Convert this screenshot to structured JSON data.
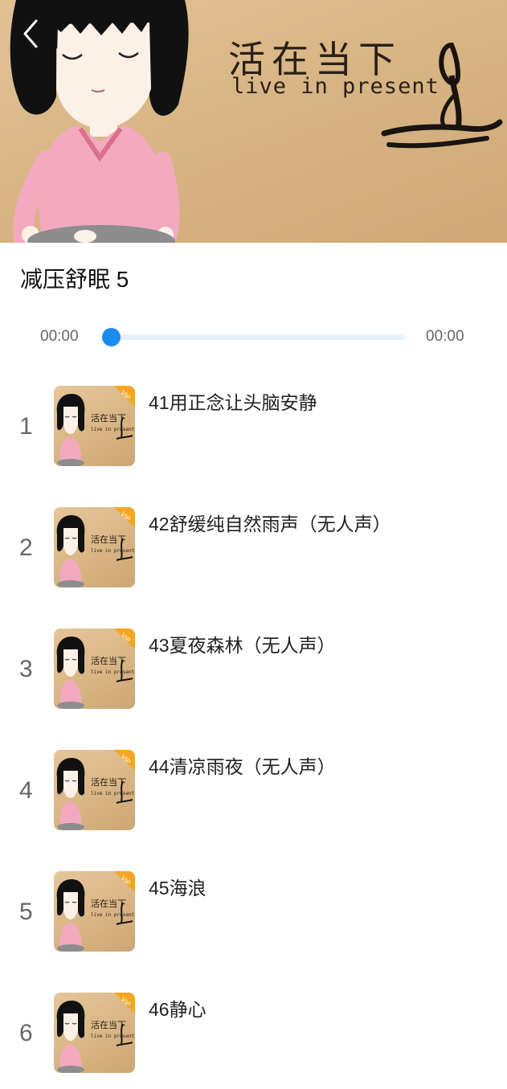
{
  "header": {
    "back_icon": "chevron-left-icon",
    "banner_title_cn": "活在当下",
    "banner_title_en": "live in present"
  },
  "album": {
    "title": "减压舒眠 5"
  },
  "player": {
    "current_time": "00:00",
    "total_time": "00:00",
    "progress": 0
  },
  "tracks": [
    {
      "index": "1",
      "title": "41用正念让头脑安静",
      "badge": "VIP"
    },
    {
      "index": "2",
      "title": "42舒缓纯自然雨声（无人声）",
      "badge": "VIP"
    },
    {
      "index": "3",
      "title": "43夏夜森林（无人声）",
      "badge": "VIP"
    },
    {
      "index": "4",
      "title": "44清凉雨夜（无人声）",
      "badge": "VIP"
    },
    {
      "index": "5",
      "title": "45海浪",
      "badge": "VIP"
    },
    {
      "index": "6",
      "title": "46静心",
      "badge": "VIP"
    }
  ],
  "thumb_text": {
    "cn": "活在当下",
    "en": "live in present"
  },
  "colors": {
    "accent": "#1a8cf0",
    "track_bg": "#e4f1fd",
    "vip_badge": "#f5a623",
    "banner_bg": "#d8b585"
  }
}
